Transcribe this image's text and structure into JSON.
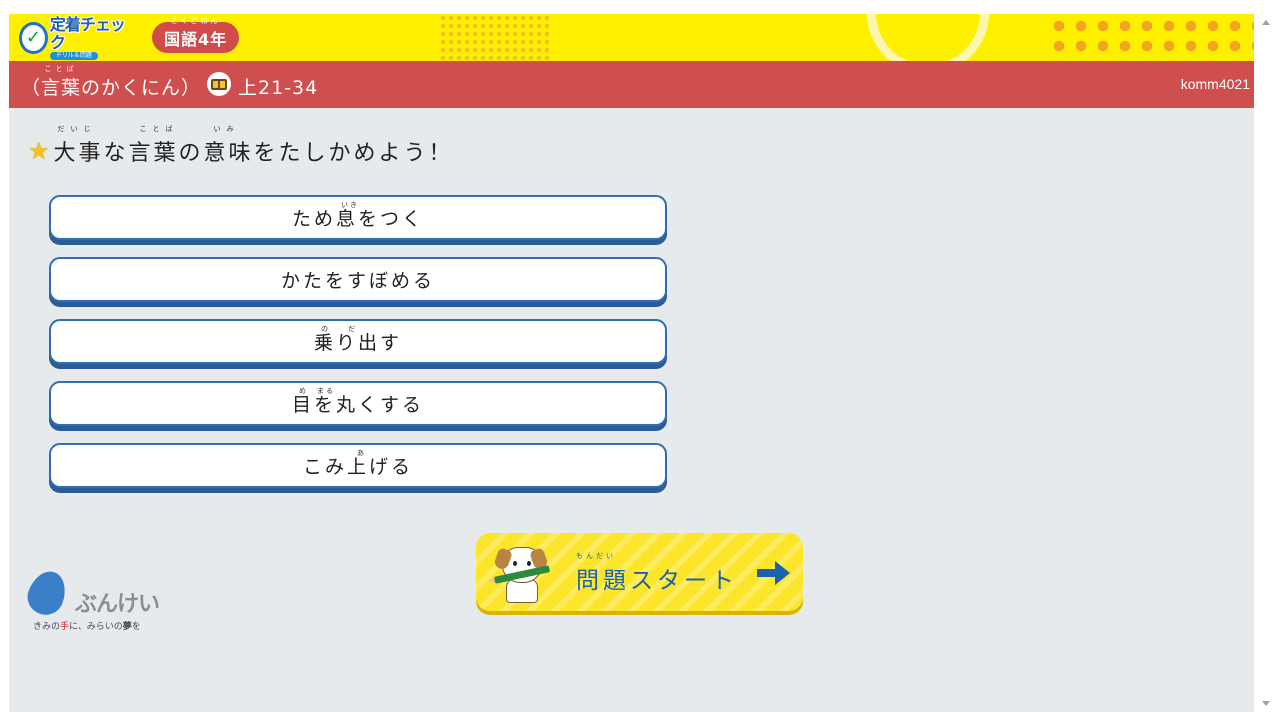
{
  "header": {
    "logo_title": "定着チェック",
    "logo_subtitle": "ドリル＆問題",
    "logo_check": "✓",
    "grade_label": "国語4年",
    "grade_furigana": "こくごねん"
  },
  "unit": {
    "title_open": "（",
    "title_word": "言葉",
    "title_word_furigana": "ことば",
    "title_rest": "のかくにん）",
    "book_icon": "book-icon",
    "page_range": "上21-34",
    "user_id": "komm4021"
  },
  "question": {
    "text": "大事な言葉の意味をたしかめよう！",
    "furigana": [
      "だいじ",
      "ことば",
      "いみ"
    ],
    "icon": "star-icon"
  },
  "choices": [
    {
      "label": "ため息をつく",
      "furigana": "いき"
    },
    {
      "label": "かたをすぼめる",
      "furigana": ""
    },
    {
      "label": "乗り出す",
      "furigana": "の　　だ"
    },
    {
      "label": "目を丸くする",
      "furigana": "め　まる"
    },
    {
      "label": "こみ上げる",
      "furigana": "あ"
    }
  ],
  "start_button": {
    "label": "問題スタート",
    "furigana": "もんだい",
    "icon": "arrow-right-icon"
  },
  "brand": {
    "name": "ぶんけい",
    "tagline_1": "きみの",
    "tagline_red": "手",
    "tagline_2": "に、みらいの",
    "tagline_bold": "夢",
    "tagline_3": "を"
  },
  "colors": {
    "top_band": "#fff000",
    "header_red": "#cf4e4e",
    "choice_border": "#2f6fb1",
    "start_yellow": "#fce52b",
    "start_text": "#1a62ae"
  }
}
